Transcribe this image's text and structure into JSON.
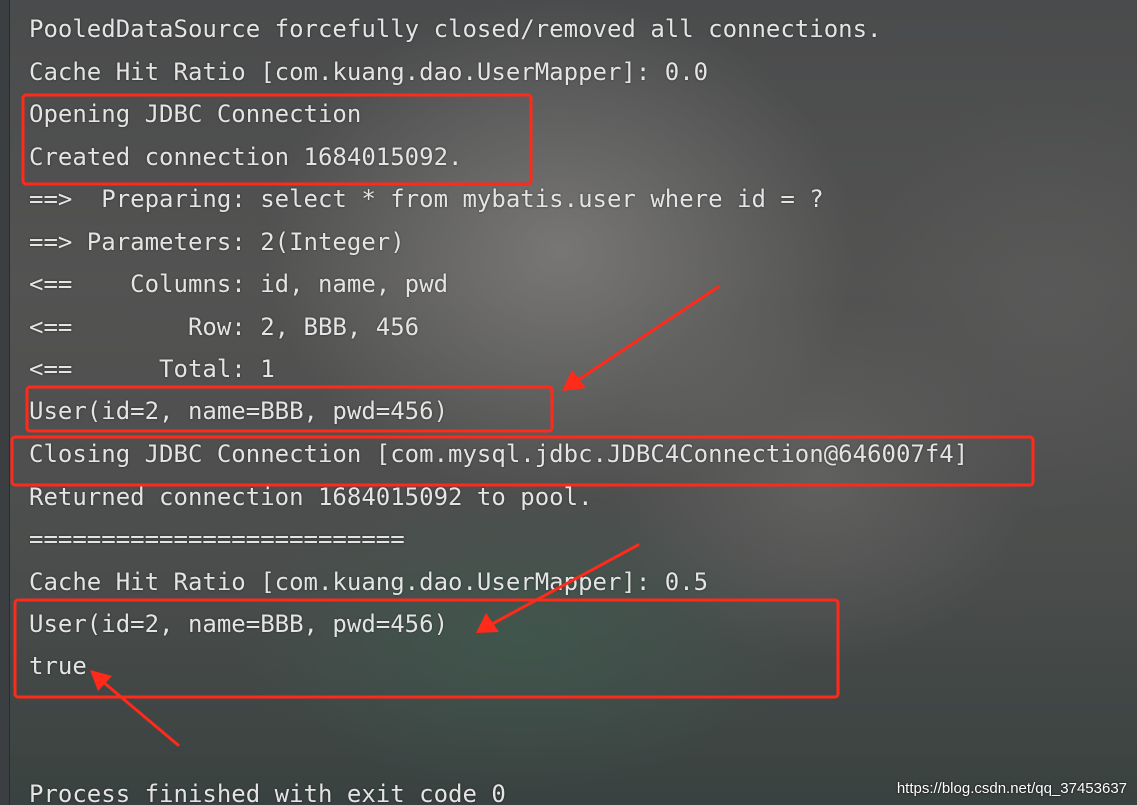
{
  "console": {
    "lines": [
      "PooledDataSource forcefully closed/removed all connections.",
      "Cache Hit Ratio [com.kuang.dao.UserMapper]: 0.0",
      "Opening JDBC Connection",
      "Created connection 1684015092.",
      "==>  Preparing: select * from mybatis.user where id = ? ",
      "==> Parameters: 2(Integer)",
      "<==    Columns: id, name, pwd",
      "<==        Row: 2, BBB, 456",
      "<==      Total: 1",
      "User(id=2, name=BBB, pwd=456)",
      "Closing JDBC Connection [com.mysql.jdbc.JDBC4Connection@646007f4]",
      "Returned connection 1684015092 to pool.",
      "==========================",
      "Cache Hit Ratio [com.kuang.dao.UserMapper]: 0.5",
      "User(id=2, name=BBB, pwd=456)",
      "true",
      "",
      "",
      "Process finished with exit code 0"
    ]
  },
  "annotation_color": "#ff2a1a",
  "watermark": "https://blog.csdn.net/qq_37453637"
}
